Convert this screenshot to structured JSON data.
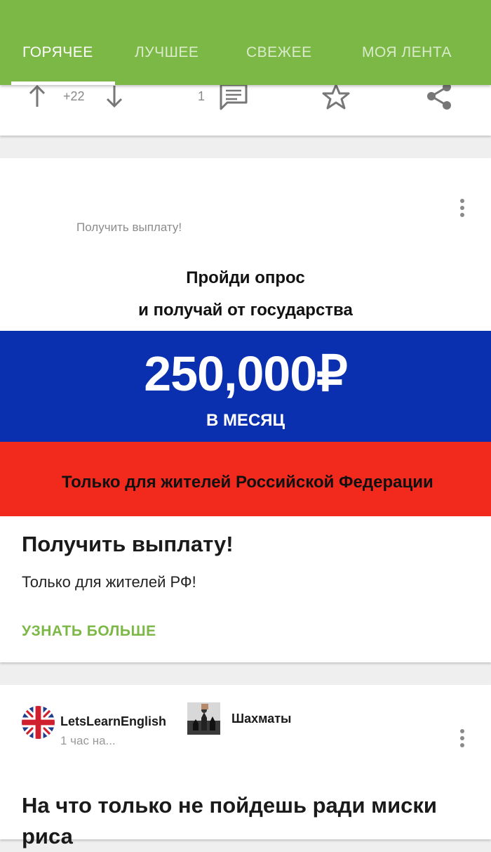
{
  "nav": {
    "tabs": [
      {
        "label": "ГОРЯЧЕЕ",
        "active": true
      },
      {
        "label": "ЛУЧШЕЕ",
        "active": false
      },
      {
        "label": "СВЕЖЕЕ",
        "active": false
      },
      {
        "label": "МОЯ ЛЕНТА",
        "active": false
      }
    ],
    "bar_color": "#7cb845"
  },
  "prev_post_actions": {
    "upvote_icon": "arrow-up-icon",
    "rating": "+22",
    "downvote_icon": "arrow-down-icon",
    "comments_count": "1",
    "comment_icon": "comment-icon",
    "save_icon": "star-icon",
    "share_icon": "share-icon"
  },
  "ad": {
    "source": "Получить выплату!",
    "banner": {
      "line1": "Пройди опрос",
      "line2": "и получай от государства",
      "amount": "250,000₽",
      "period": "В МЕСЯЦ",
      "note": "Только для жителей Российской Федерации"
    },
    "title": "Получить выплату!",
    "description": "Только для жителей РФ!",
    "cta": "УЗНАТЬ БОЛЬШЕ",
    "menu_icon": "more-vertical-icon"
  },
  "post": {
    "author": "LetsLearnEnglish",
    "time": "1 час на...",
    "community": "Шахматы",
    "title": "На что только не пойдешь ради миски риса",
    "menu_icon": "more-vertical-icon"
  }
}
